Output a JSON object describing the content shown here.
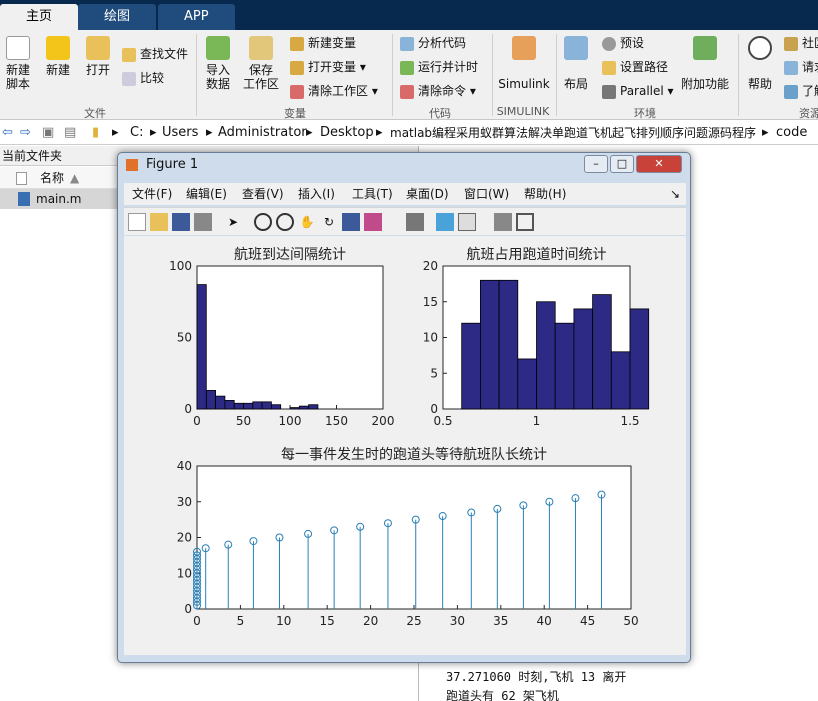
{
  "tabs": [
    "主页",
    "绘图",
    "APP"
  ],
  "ribbon": {
    "new_script": "新建\n脚本",
    "new": "新建",
    "open": "打开",
    "find_files": "查找文件",
    "compare": "比较",
    "import_data": "导入\n数据",
    "save_workspace": "保存\n工作区",
    "new_variable": "新建变量",
    "open_variable": "打开变量",
    "clear_workspace": "清除工作区",
    "analyze_code": "分析代码",
    "run_and_time": "运行并计时",
    "clear_commands": "清除命令",
    "simulink": "Simulink",
    "layout": "布局",
    "preferences": "预设",
    "set_path": "设置路径",
    "parallel": "Parallel",
    "add_ons": "附加功能",
    "help": "帮助",
    "community": "社区",
    "request": "请求",
    "learn": "了解",
    "groups": {
      "file": "文件",
      "variable": "变量",
      "code": "代码",
      "simulink": "SIMULINK",
      "environment": "环境",
      "resources": "资源"
    }
  },
  "address": [
    "C:",
    "Users",
    "Administrator",
    "Desktop",
    "matlab编程采用蚁群算法解决单跑道飞机起飞排列顺序问题源码程序",
    "code"
  ],
  "current_folder": {
    "title": "当前文件夹",
    "col_name": "名称",
    "file": "main.m"
  },
  "command_window": {
    "line1": "37.271060 时刻,飞机 13 离开",
    "line2": "跑道头有 62 架飞机"
  },
  "figure": {
    "title": "Figure 1",
    "menu": [
      "文件(F)",
      "编辑(E)",
      "查看(V)",
      "插入(I)",
      "工具(T)",
      "桌面(D)",
      "窗口(W)",
      "帮助(H)"
    ],
    "color_bar": "#2c2a84",
    "color_stem": "#2a7fb4"
  },
  "chart_data": [
    {
      "type": "bar",
      "title": "航班到达间隔统计",
      "x": [
        5,
        15,
        25,
        35,
        45,
        55,
        65,
        75,
        85,
        95,
        105,
        115,
        125,
        135,
        145,
        155
      ],
      "values": [
        87,
        13,
        9,
        6,
        4,
        4,
        5,
        5,
        3,
        0,
        1,
        2,
        3,
        0,
        0,
        0
      ],
      "xlim": [
        0,
        200
      ],
      "ylim": [
        0,
        100
      ],
      "xticks": [
        0,
        50,
        100,
        150,
        200
      ],
      "yticks": [
        0,
        50,
        100
      ]
    },
    {
      "type": "bar",
      "title": "航班占用跑道时间统计",
      "x": [
        0.65,
        0.75,
        0.85,
        0.95,
        1.05,
        1.15,
        1.25,
        1.35,
        1.45
      ],
      "values": [
        12,
        18,
        18,
        7,
        15,
        12,
        14,
        16,
        8,
        14
      ],
      "bins": [
        0.6,
        0.7,
        0.8,
        0.9,
        1.0,
        1.1,
        1.2,
        1.3,
        1.4,
        1.5
      ],
      "xlim": [
        0.5,
        1.5
      ],
      "ylim": [
        0,
        20
      ],
      "xticks": [
        0.5,
        1,
        1.5
      ],
      "yticks": [
        0,
        5,
        10,
        15,
        20
      ]
    },
    {
      "type": "scatter",
      "title": "每一事件发生时的跑道头等待航班队长统计",
      "x": [
        0,
        0,
        0,
        0,
        0,
        0,
        0,
        0,
        0,
        0,
        0,
        0,
        0,
        0,
        0,
        0,
        1,
        3.6,
        6.5,
        9.5,
        12.8,
        15.8,
        18.8,
        22,
        25.2,
        28.3,
        31.6,
        34.6,
        37.6,
        40.6,
        43.6,
        46.6
      ],
      "y": [
        1,
        2,
        3,
        4,
        5,
        6,
        7,
        8,
        9,
        10,
        11,
        12,
        13,
        14,
        15,
        16,
        17,
        18,
        19,
        20,
        21,
        22,
        23,
        24,
        25,
        26,
        27,
        28,
        29,
        30,
        31,
        32
      ],
      "xlim": [
        0,
        50
      ],
      "ylim": [
        0,
        40
      ],
      "xticks": [
        0,
        5,
        10,
        15,
        20,
        25,
        30,
        35,
        40,
        45,
        50
      ],
      "yticks": [
        0,
        10,
        20,
        30,
        40
      ],
      "style": "stem"
    }
  ]
}
